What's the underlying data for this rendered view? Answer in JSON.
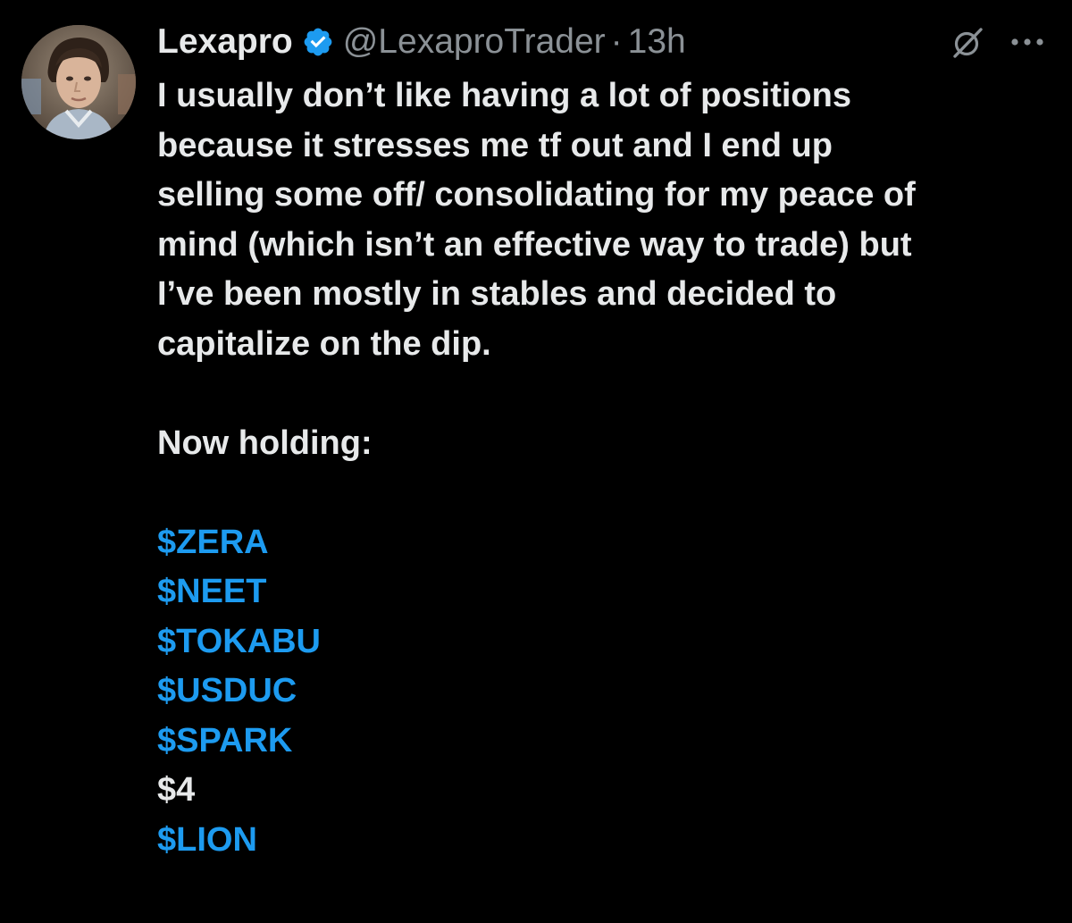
{
  "author": {
    "name": "Lexapro",
    "handle": "@LexaproTrader",
    "separator": "·",
    "time": "13h",
    "verified_color": "#1d9bf0"
  },
  "icons": {
    "verified": "verified-badge-icon",
    "grok": "grok-icon",
    "more": "more-options-icon"
  },
  "tweet": {
    "lines": [
      "I usually don’t like having a lot of positions",
      "because it stresses me tf out and I end up",
      "selling some off/ consolidating for my peace of",
      "mind (which isn’t an effective way to trade) but",
      "I’ve been mostly in stables and decided to",
      "capitalize on the dip."
    ],
    "holding_label": "Now holding:",
    "tickers": [
      "$ZERA",
      "$NEET",
      "$TOKABU",
      "$USDUC",
      "$SPARK",
      "$4",
      "$LION"
    ]
  },
  "colors": {
    "background": "#000000",
    "text": "#e7e9ea",
    "muted": "#8b9196",
    "link": "#1d9bf0"
  }
}
